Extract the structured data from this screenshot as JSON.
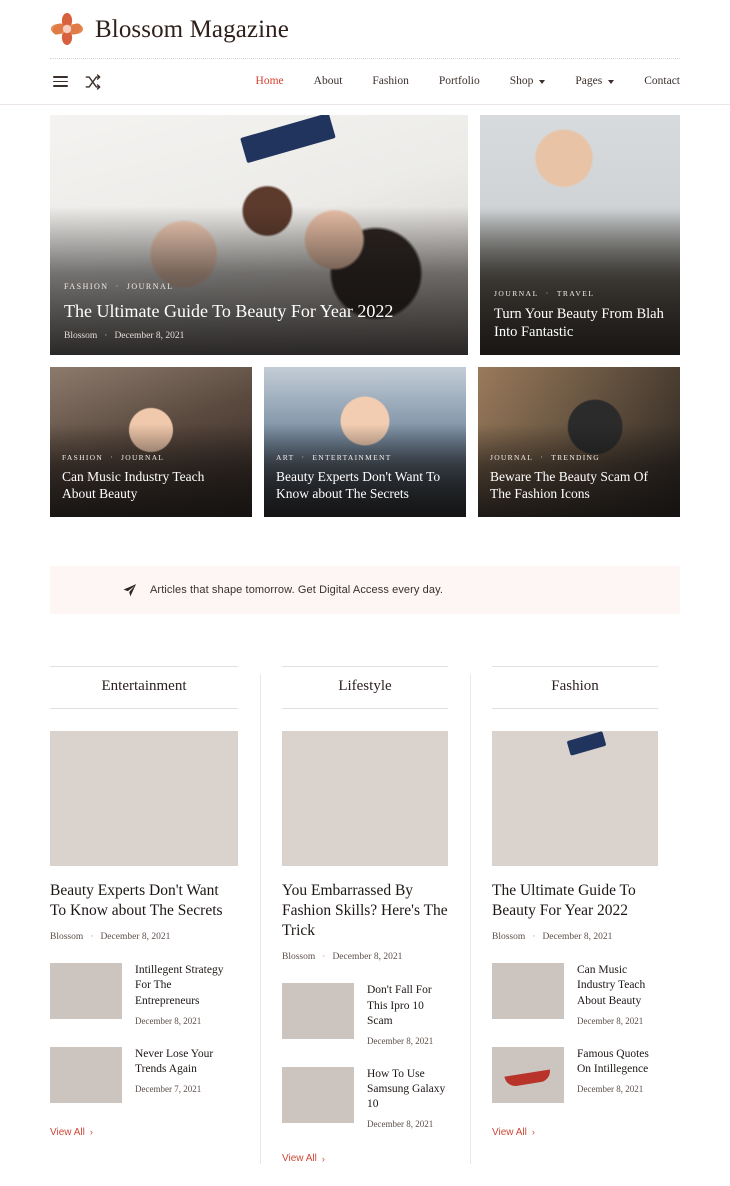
{
  "site": {
    "logo_icon": "flower-icon",
    "title": "Blossom Magazine",
    "accent_color": "#d4402f",
    "link_color": "#cf4736",
    "promo_bg": "#fdf6f4"
  },
  "nav": {
    "menu_icon": "hamburger-menu-icon",
    "shuffle_icon": "shuffle-icon",
    "items": [
      {
        "label": "Home",
        "active": true,
        "has_dropdown": false
      },
      {
        "label": "About",
        "active": false,
        "has_dropdown": false
      },
      {
        "label": "Fashion",
        "active": false,
        "has_dropdown": false
      },
      {
        "label": "Portfolio",
        "active": false,
        "has_dropdown": false
      },
      {
        "label": "Shop",
        "active": false,
        "has_dropdown": true
      },
      {
        "label": "Pages",
        "active": false,
        "has_dropdown": true
      },
      {
        "label": "Contact",
        "active": false,
        "has_dropdown": false
      }
    ]
  },
  "hero": {
    "main": {
      "categories": [
        "FASHION",
        "JOURNAL"
      ],
      "separator": "·",
      "title": "The Ultimate Guide To Beauty For Year 2022",
      "author": "Blossom",
      "date": "December 8, 2021",
      "meta_sep": "·",
      "image": "group-selfie-photo"
    },
    "side": {
      "categories": [
        "JOURNAL",
        "TRAVEL"
      ],
      "separator": "·",
      "title": "Turn Your Beauty From Blah Into Fantastic",
      "image": "woman-sunglasses-car-photo"
    }
  },
  "trio": [
    {
      "categories": [
        "FASHION",
        "JOURNAL"
      ],
      "separator": "·",
      "title": "Can Music Industry Teach About Beauty",
      "image": "woman-smiling-photo"
    },
    {
      "categories": [
        "ART",
        "ENTERTAINMENT"
      ],
      "separator": "·",
      "title": "Beauty Experts Don't Want To Know about The Secrets",
      "image": "woman-peace-sign-photo"
    },
    {
      "categories": [
        "JOURNAL",
        "TRENDING"
      ],
      "separator": "·",
      "title": "Beware The Beauty Scam Of The Fashion Icons",
      "image": "gas-mask-photo"
    }
  ],
  "promo": {
    "icon": "paper-plane-icon",
    "text": "Articles that shape tomorrow. Get Digital Access every day."
  },
  "columns": [
    {
      "heading": "Entertainment",
      "featured": {
        "image": "woman-peace-sign-blue-jacket-photo",
        "title": "Beauty Experts Don't Want To Know about The Secrets",
        "author": "Blossom",
        "meta_sep": "·",
        "date": "December 8, 2021"
      },
      "items": [
        {
          "image": "singer-on-stage-photo",
          "title": "Intillegent Strategy For The Entrepreneurs",
          "date": "December 8, 2021"
        },
        {
          "image": "couple-piggyback-photo",
          "title": "Never Lose Your Trends Again",
          "date": "December 7, 2021"
        }
      ],
      "view_all": "View All",
      "view_all_chevron": "›"
    },
    {
      "heading": "Lifestyle",
      "featured": {
        "image": "cyclist-photo",
        "title": "You Embarrassed By Fashion Skills? Here's The Trick",
        "author": "Blossom",
        "meta_sep": "·",
        "date": "December 8, 2021"
      },
      "items": [
        {
          "image": "colorful-phone-photo",
          "title": "Don't Fall For This Ipro 10 Scam",
          "date": "December 8, 2021"
        },
        {
          "image": "tablet-flowers-photo",
          "title": "How To Use Samsung Galaxy 10",
          "date": "December 8, 2021"
        }
      ],
      "view_all": "View All",
      "view_all_chevron": "›"
    },
    {
      "heading": "Fashion",
      "featured": {
        "image": "group-selfie-photo",
        "title": "The Ultimate Guide To Beauty For Year 2022",
        "author": "Blossom",
        "meta_sep": "·",
        "date": "December 8, 2021"
      },
      "items": [
        {
          "image": "woman-portrait-photo",
          "title": "Can Music Industry Teach About Beauty",
          "date": "December 8, 2021"
        },
        {
          "image": "hammock-mountain-photo",
          "title": "Famous Quotes On Intillegence",
          "date": "December 8, 2021"
        }
      ],
      "view_all": "View All",
      "view_all_chevron": "›"
    }
  ]
}
